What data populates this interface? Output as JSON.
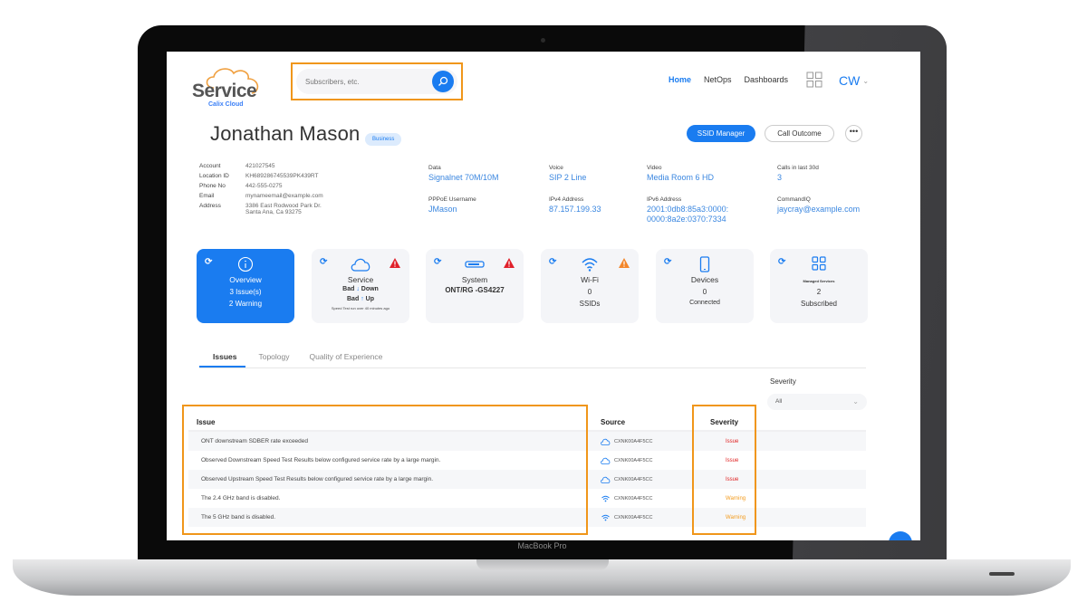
{
  "device": {
    "label": "MacBook Pro"
  },
  "app": {
    "logo": {
      "word": "Service",
      "sub": "Calix Cloud"
    },
    "search": {
      "placeholder": "Subscribers, etc."
    },
    "nav": [
      {
        "label": "Home",
        "active": true
      },
      {
        "label": "NetOps",
        "active": false
      },
      {
        "label": "Dashboards",
        "active": false
      }
    ],
    "user_initials": "CW"
  },
  "subscriber": {
    "name": "Jonathan Mason",
    "badge": "Business",
    "actions": {
      "ssid_manager": "SSID Manager",
      "call_outcome": "Call Outcome",
      "more": "•••"
    },
    "details": [
      {
        "key": "Account",
        "value": "421027545"
      },
      {
        "key": "Location ID",
        "value": "KH689286745539PK439RT"
      },
      {
        "key": "Phone No",
        "value": "442-555-0275"
      },
      {
        "key": "Email",
        "value": "mynameemail@example.com"
      },
      {
        "key": "Address",
        "value": "3386 East Rodwood Park Dr.",
        "value2": "Santa Ana, Ca 93275"
      }
    ],
    "fields": {
      "data": {
        "label": "Data",
        "value": "Signalnet 70M/10M"
      },
      "voice": {
        "label": "Voice",
        "value": "SIP 2 Line"
      },
      "video": {
        "label": "Video",
        "value": "Media Room 6 HD"
      },
      "calls": {
        "label": "Calls in last 30d",
        "value": "3"
      },
      "pppoe": {
        "label": "PPPoE Username",
        "value": "JMason"
      },
      "ipv4": {
        "label": "IPv4 Address",
        "value": "87.157.199.33"
      },
      "ipv6": {
        "label": "IPv6 Address",
        "value": "2001:0db8:85a3:0000:",
        "value2": "0000:8a2e:0370:7334"
      },
      "commandiq": {
        "label": "CommandIQ",
        "value": "jaycray@example.com"
      }
    }
  },
  "cards": {
    "overview": {
      "title": "Overview",
      "line2": "3 Issue(s)",
      "line3": "2 Warning"
    },
    "service": {
      "title": "Service",
      "down_status": "Bad",
      "down_arrow": "↓",
      "down_label": "Down",
      "up_status": "Bad",
      "up_arrow": "↑",
      "up_label": "Up",
      "note": "Speed Test run over 40 minutes ago"
    },
    "system": {
      "title": "System",
      "line2": "ONT/RG -GS4227"
    },
    "wifi": {
      "title": "Wi-Fi",
      "line2": "0",
      "line3": "SSIDs"
    },
    "devices": {
      "title": "Devices",
      "line2": "0",
      "line3": "Connected"
    },
    "managed": {
      "title": "Managed Services",
      "line2": "2",
      "line3": "Subscribed"
    }
  },
  "tabs": [
    {
      "label": "Issues",
      "active": true
    },
    {
      "label": "Topology",
      "active": false
    },
    {
      "label": "Quality of Experience",
      "active": false
    }
  ],
  "filter": {
    "label": "Severity",
    "value": "All"
  },
  "issues_table": {
    "headers": {
      "issue": "Issue",
      "source": "Source",
      "severity": "Severity"
    },
    "rows": [
      {
        "issue": "ONT downstream SDBER rate exceeded",
        "source_icon": "cloud",
        "source": "CXNK00A4F5CC",
        "severity": "Issue"
      },
      {
        "issue": "Observed Downstream Speed Test Results below configured service rate by a large margin.",
        "source_icon": "cloud",
        "source": "CXNK00A4F5CC",
        "severity": "Issue"
      },
      {
        "issue": "Observed Upstream Speed Test Results below configured service rate by a large margin.",
        "source_icon": "cloud",
        "source": "CXNK00A4F5CC",
        "severity": "Issue"
      },
      {
        "issue": "The 2.4 GHz band is disabled.",
        "source_icon": "wifi",
        "source": "CXNK00A4F5CC",
        "severity": "Warning"
      },
      {
        "issue": "The 5 GHz band is disabled.",
        "source_icon": "wifi",
        "source": "CXNK00A4F5CC",
        "severity": "Warning"
      }
    ]
  },
  "colors": {
    "accent": "#1a7cf0",
    "issue": "#e02020",
    "warning": "#f39a1a",
    "highlight": "#f0961a"
  }
}
